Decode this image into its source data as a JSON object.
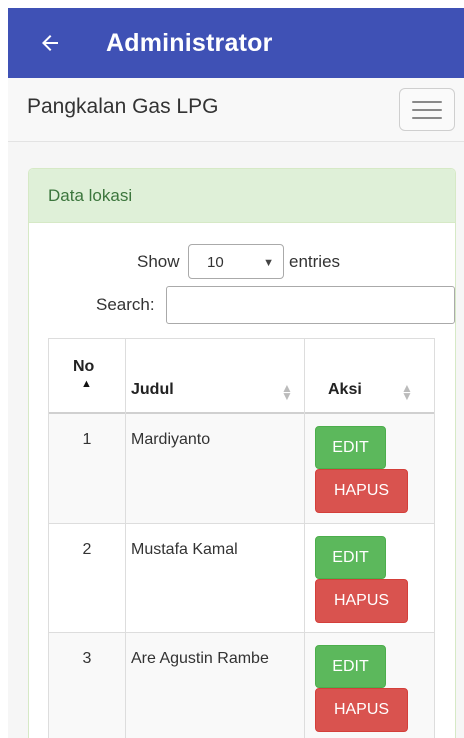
{
  "appbar": {
    "title": "Administrator",
    "back_icon": "arrow-left-icon",
    "color": "#3f51b5"
  },
  "navbar": {
    "brand": "Pangkalan Gas LPG",
    "menu_icon": "hamburger-menu-icon"
  },
  "panel": {
    "heading": "Data lokasi",
    "heading_color": "#3c763d",
    "heading_bg": "#dff0d8"
  },
  "datatable": {
    "length": {
      "show_label": "Show",
      "selected": "10",
      "entries_label": "entries"
    },
    "search": {
      "label": "Search:",
      "value": ""
    },
    "columns": [
      {
        "label": "No",
        "sort": "ascending"
      },
      {
        "label": "Judul",
        "sort": "unsorted"
      },
      {
        "label": "Aksi",
        "sort": "unsorted"
      }
    ],
    "rows": [
      {
        "no": "1",
        "judul": "Mardiyanto",
        "edit": "EDIT",
        "hapus": "HAPUS"
      },
      {
        "no": "2",
        "judul": "Mustafa Kamal",
        "edit": "EDIT",
        "hapus": "HAPUS"
      },
      {
        "no": "3",
        "judul": "Are Agustin Rambe",
        "edit": "EDIT",
        "hapus": "HAPUS"
      }
    ]
  },
  "colors": {
    "edit_button": "#5cb85c",
    "hapus_button": "#d9534f"
  }
}
